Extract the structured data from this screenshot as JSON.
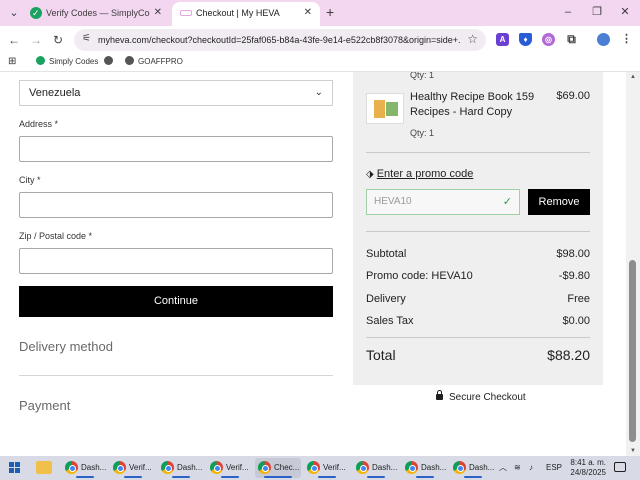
{
  "browser": {
    "tabs": [
      {
        "title": "Verify Codes — SimplyCodes",
        "active": false
      },
      {
        "title": "Checkout | My HEVA",
        "active": true
      }
    ],
    "url": "myheva.com/checkout?checkoutId=25faf065-b84a-43fe-9e14-e522cb8f3078&origin=side+...",
    "bookmarks": [
      {
        "label": "Simply Codes"
      },
      {
        "label": ""
      },
      {
        "label": "GOAFFPRO"
      }
    ],
    "icons": {
      "menu": "tab-search-icon",
      "back": "back-arrow-icon",
      "forward": "forward-arrow-icon",
      "reload": "reload-icon",
      "site_info": "tune-icon",
      "bookmark": "star-icon",
      "extensions": "puzzle-icon",
      "more": "kebab-menu-icon"
    }
  },
  "form": {
    "country_value": "Venezuela",
    "address_label": "Address *",
    "city_label": "City *",
    "zip_label": "Zip / Postal code *",
    "continue_label": "Continue",
    "delivery_title": "Delivery method",
    "payment_title": "Payment"
  },
  "summary": {
    "prev_qty": "Qty: 1",
    "item": {
      "name": "Healthy Recipe Book 159 Recipes - Hard Copy",
      "price": "$69.00",
      "qty": "Qty: 1"
    },
    "promo_link": "Enter a promo code",
    "promo_code": "HEVA10",
    "remove_label": "Remove",
    "rows": [
      {
        "label": "Subtotal",
        "value": "$98.00"
      },
      {
        "label": "Promo code: HEVA10",
        "value": "-$9.80"
      },
      {
        "label": "Delivery",
        "value": "Free"
      },
      {
        "label": "Sales Tax",
        "value": "$0.00"
      }
    ],
    "total_label": "Total",
    "total_value": "$88.20",
    "secure_label": "Secure Checkout"
  },
  "taskbar": {
    "items": [
      {
        "label": "Dash...",
        "active": false
      },
      {
        "label": "Verif...",
        "active": false
      },
      {
        "label": "Dash...",
        "active": false
      },
      {
        "label": "Verif...",
        "active": false
      },
      {
        "label": "Chec...",
        "active": true
      },
      {
        "label": "Verif...",
        "active": false
      },
      {
        "label": "Dash...",
        "active": false
      },
      {
        "label": "Dash...",
        "active": false
      },
      {
        "label": "Dash...",
        "active": false
      }
    ],
    "language": "ESP",
    "time": "8:41 a. m.",
    "date": "24/8/2025"
  },
  "colors": {
    "tabstrip": "#f3d7f1",
    "button": "#000000",
    "promo_valid": "#2e9a48",
    "panel": "#efefef"
  }
}
